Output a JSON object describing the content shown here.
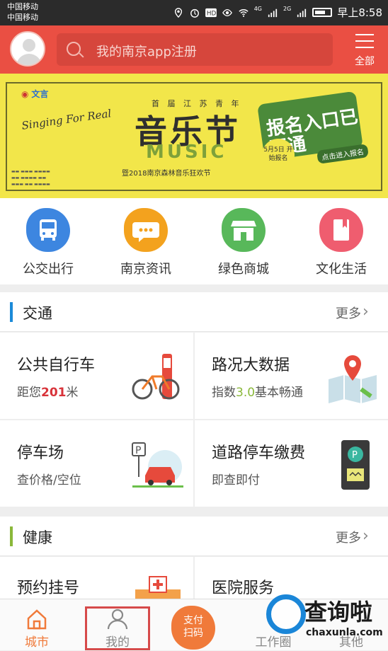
{
  "status_bar": {
    "carrier_1": "中国移动",
    "carrier_2": "中国移动",
    "time": "早上8:58",
    "signal_labels": [
      "4G",
      "2G"
    ]
  },
  "header": {
    "search_placeholder": "我的南京app注册",
    "menu_label": "全部"
  },
  "banner": {
    "eyebrow": "首 届 江 苏 青 年",
    "title": "音乐节",
    "title_en": "MUSIC",
    "subtitle": "暨2018南京森林音乐狂欢节",
    "slogan": "Singing For Real",
    "badge": "报名入口已开通",
    "date": "5月5日 开始报名",
    "cta": "点击进入报名",
    "logo_text": "文言"
  },
  "quick_links": [
    {
      "label": "公交出行",
      "icon": "bus-icon",
      "color": "#3d86e0"
    },
    {
      "label": "南京资讯",
      "icon": "chat-icon",
      "color": "#f3a21e"
    },
    {
      "label": "绿色商城",
      "icon": "shop-icon",
      "color": "#58b85a"
    },
    {
      "label": "文化生活",
      "icon": "book-icon",
      "color": "#ef5d6f"
    }
  ],
  "traffic": {
    "title": "交通",
    "more": "更多",
    "cards": [
      {
        "title": "公共自行车",
        "sub_prefix": "距您",
        "sub_highlight": "201",
        "sub_suffix": "米"
      },
      {
        "title": "路况大数据",
        "sub_prefix": "指数",
        "sub_highlight": "3.0",
        "sub_suffix": "基本畅通"
      },
      {
        "title": "停车场",
        "sub": "查价格/空位"
      },
      {
        "title": "道路停车缴费",
        "sub": "即查即付"
      }
    ]
  },
  "health": {
    "title": "健康",
    "more": "更多",
    "cards": [
      {
        "title": "预约挂号"
      },
      {
        "title": "医院服务"
      }
    ]
  },
  "bottom_nav": {
    "tabs": [
      "城市",
      "我的",
      "工作圈",
      "其他"
    ],
    "pay_line1": "支付",
    "pay_line2": "扫码"
  },
  "watermark": {
    "big": "查询啦",
    "small": "chaxunla.com"
  },
  "colors": {
    "header_red": "#ea4f43",
    "banner_yellow": "#f2e64a",
    "accent_blue": "#1b8ad8",
    "health_green": "#8ab83a",
    "pay_orange": "#f07a3a"
  }
}
